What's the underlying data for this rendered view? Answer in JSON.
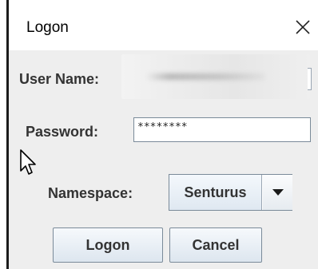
{
  "window": {
    "title": "Logon",
    "close_glyph": "✕"
  },
  "form": {
    "username": {
      "label": "User Name:",
      "value": ""
    },
    "password": {
      "label": "Password:",
      "value": "********"
    },
    "namespace": {
      "label": "Namespace:",
      "selected": "Senturus"
    }
  },
  "buttons": {
    "logon_label": "Logon",
    "cancel_label": "Cancel"
  },
  "icons": {
    "close": "close-icon",
    "dropdown": "dropdown-arrow-icon",
    "cursor": "mouse-pointer-icon"
  },
  "colors": {
    "panel_background": "#eeeeee",
    "label_text": "#333333",
    "field_border": "#7a8a99",
    "button_gradient_top": "#f6f9fc",
    "button_gradient_bottom": "#dde6ef"
  }
}
